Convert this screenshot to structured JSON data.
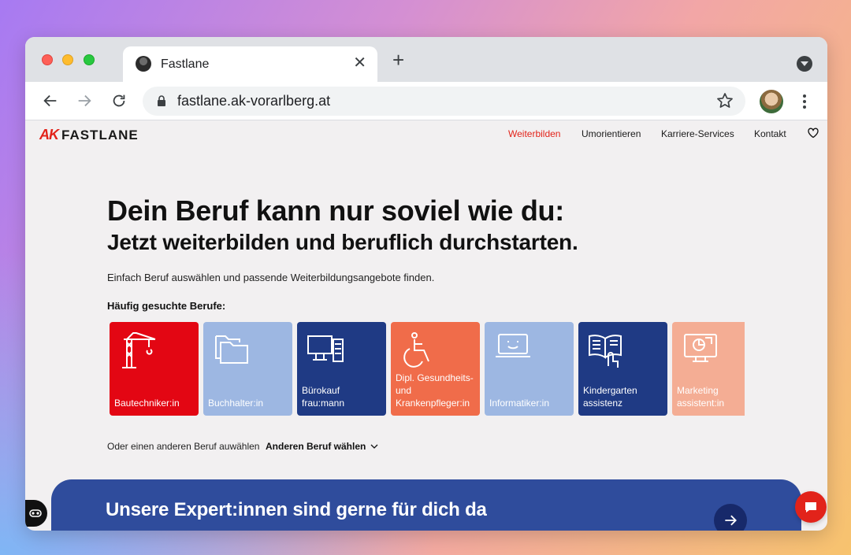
{
  "browser": {
    "tab_title": "Fastlane",
    "url": "fastlane.ak-vorarlberg.at"
  },
  "site": {
    "logo_mark": "AK",
    "logo_text": "FASTLANE",
    "nav": [
      "Weiterbilden",
      "Umorientieren",
      "Karriere-Services",
      "Kontakt"
    ],
    "accent_color": "#e2231a"
  },
  "hero": {
    "title": "Dein Beruf kann nur soviel wie du:",
    "subtitle": "Jetzt weiterbilden und beruflich durchstarten.",
    "lead": "Einfach Beruf auswählen und passende Weiterbildungsangebote finden.",
    "popular_heading": "Häufig gesuchte Berufe:"
  },
  "cards": [
    {
      "label": "Bautechniker:in",
      "icon": "crane-icon",
      "color": "#e30613"
    },
    {
      "label": "Buchhalter:in",
      "icon": "folder-icon",
      "color": "#9db7e2"
    },
    {
      "label": "Bürokauf\nfrau:mann",
      "icon": "computer-icon",
      "color": "#1f3a84"
    },
    {
      "label": "Dipl. Gesundheits-\nund\nKrankenpfleger:in",
      "icon": "wheelchair-icon",
      "color": "#f06c4a"
    },
    {
      "label": "Informatiker:in",
      "icon": "laptop-smile-icon",
      "color": "#9db7e2"
    },
    {
      "label": "Kindergarten\nassistenz",
      "icon": "book-hand-icon",
      "color": "#1f3a84"
    },
    {
      "label": "Marketing\nassistent:in",
      "icon": "monitor-chart-icon",
      "color": "#f4ad94"
    }
  ],
  "other": {
    "text": "Oder einen anderen Beruf auwählen",
    "button": "Anderen Beruf wählen"
  },
  "banner": {
    "text": "Unsere Expert:innen sind gerne für dich da"
  }
}
